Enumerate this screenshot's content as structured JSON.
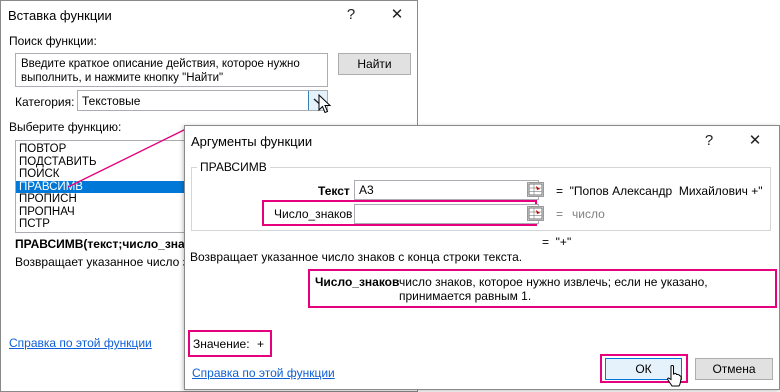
{
  "insert_dialog": {
    "title": "Вставка функции",
    "help_glyph": "?",
    "close_glyph": "✕",
    "search_label": "Поиск функции:",
    "search_text": "Введите краткое описание действия, которое нужно выполнить, и нажмите кнопку \"Найти\"",
    "find_button": "Найти",
    "category_label": "Категория:",
    "category_value": "Текстовые",
    "select_label": "Выберите функцию:",
    "functions": [
      "ПОВТОР",
      "ПОДСТАВИТЬ",
      "ПОИСК",
      "ПРАВСИМВ",
      "ПРОПИСН",
      "ПРОПНАЧ",
      "ПСТР"
    ],
    "selected_index": 3,
    "signature": "ПРАВСИМВ(текст;число_знаков)",
    "description": "Возвращает указанное число знаков с конца строки текста.",
    "help_link": "Справка по этой функции"
  },
  "args_dialog": {
    "title": "Аргументы функции",
    "help_glyph": "?",
    "close_glyph": "✕",
    "function_name": "ПРАВСИМВ",
    "arg1_label": "Текст",
    "arg1_value": "A3",
    "arg1_result": "=  \"Попов Александр  Михайлович +\"",
    "arg2_label": "Число_знаков",
    "arg2_value": "",
    "arg2_result_eq": "=",
    "arg2_result": "число",
    "formula_result": "=  \"+\"",
    "description": "Возвращает указанное число знаков с конца строки текста.",
    "param_name": "Число_знаков",
    "param_desc": "число знаков, которое нужно извлечь; если не указано, принимается равным 1.",
    "value_label": "Значение:",
    "value": "+",
    "help_link": "Справка по этой функции",
    "ok_button": "ОК",
    "cancel_button": "Отмена"
  },
  "colors": {
    "highlight": "#e6007e",
    "selection": "#0078d7",
    "link": "#0f5fd6"
  }
}
